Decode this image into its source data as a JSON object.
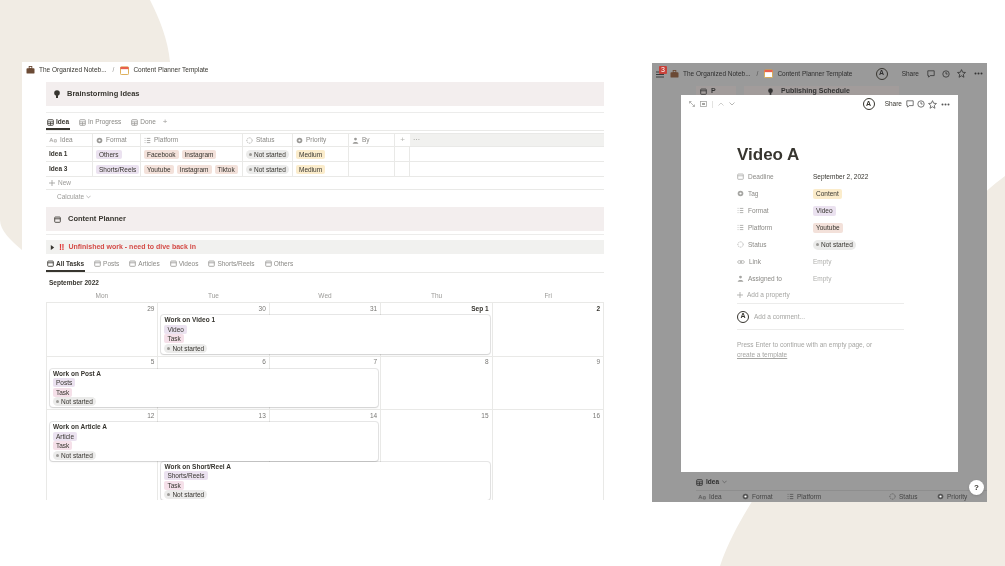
{
  "left_window": {
    "breadcrumb": [
      {
        "text": "The Organized Noteb..."
      },
      {
        "text": "Content Planner Template"
      }
    ],
    "breadcrumb_separator": "/",
    "brainstorm": {
      "title": "Brainstorming Ideas",
      "views": [
        {
          "label": "Idea",
          "selected": true
        },
        {
          "label": "In Progress",
          "selected": false
        },
        {
          "label": "Done",
          "selected": false
        }
      ],
      "add_view": "+",
      "columns": [
        {
          "label": "Idea",
          "kind": "title"
        },
        {
          "label": "Format",
          "kind": "select"
        },
        {
          "label": "Platform",
          "kind": "multi_select"
        },
        {
          "label": "Status",
          "kind": "status"
        },
        {
          "label": "Priority",
          "kind": "select"
        },
        {
          "label": "By",
          "kind": "person"
        }
      ],
      "add_column": "+",
      "more": "···",
      "rows": [
        {
          "cells": [
            {
              "text": "Idea 1"
            },
            {
              "tags": [
                {
                  "text": "Others",
                  "color": "#ebe2f0"
                }
              ]
            },
            {
              "tags": [
                {
                  "text": "Facebook",
                  "color": "#f3e1da"
                },
                {
                  "text": "Instagram",
                  "color": "#f3e1da"
                }
              ]
            },
            {
              "status": "Not started"
            },
            {
              "tags": [
                {
                  "text": "Medium",
                  "color": "#fbeccb"
                }
              ]
            }
          ]
        },
        {
          "cells": [
            {
              "text": "Idea 3"
            },
            {
              "tags": [
                {
                  "text": "Shorts/Reels",
                  "color": "#ebe2f0"
                }
              ]
            },
            {
              "tags": [
                {
                  "text": "Youtube",
                  "color": "#f3e1da"
                },
                {
                  "text": "Instagram",
                  "color": "#f3e1da"
                },
                {
                  "text": "Tiktok",
                  "color": "#f3e1da"
                }
              ]
            },
            {
              "status": "Not started"
            },
            {
              "tags": [
                {
                  "text": "Medium",
                  "color": "#fbeccb"
                }
              ]
            }
          ]
        }
      ],
      "new_label": "New",
      "calculate_label": "Calculate"
    },
    "planner": {
      "title": "Content Planner",
      "toggle": {
        "mark": "‼",
        "text": "Unfinished work - need to dive back in",
        "expanded": false
      },
      "views": [
        {
          "label": "All Tasks",
          "selected": true
        },
        {
          "label": "Posts",
          "selected": false
        },
        {
          "label": "Articles",
          "selected": false
        },
        {
          "label": "Videos",
          "selected": false
        },
        {
          "label": "Shorts/Reels",
          "selected": false
        },
        {
          "label": "Others",
          "selected": false
        }
      ],
      "month": "September 2022",
      "weekdays": [
        "Mon",
        "Tue",
        "Wed",
        "Thu",
        "Fri"
      ],
      "weeks": [
        {
          "days": [
            {
              "label": "29",
              "emphasized": false
            },
            {
              "label": "30",
              "emphasized": false
            },
            {
              "label": "31",
              "emphasized": false
            },
            {
              "label": "Sep 1",
              "emphasized": true
            },
            {
              "label": "2",
              "emphasized": true
            }
          ],
          "lanes": [
            [
              {
                "kind": "empty"
              },
              {
                "kind": "event",
                "title": "Work on Video 1",
                "tags": [
                  {
                    "text": "Video",
                    "color": "#ebe2f0"
                  },
                  {
                    "text": "Task",
                    "color": "#f5e0e9"
                  }
                ],
                "status": "Not started"
              },
              {
                "kind": "continued"
              },
              {
                "kind": "continued"
              },
              {
                "kind": "empty"
              }
            ]
          ]
        },
        {
          "days": [
            {
              "label": "5",
              "emphasized": false
            },
            {
              "label": "6",
              "emphasized": false
            },
            {
              "label": "7",
              "emphasized": false
            },
            {
              "label": "8",
              "emphasized": false
            },
            {
              "label": "9",
              "emphasized": false
            }
          ],
          "lanes": [
            [
              {
                "kind": "event",
                "title": "Work on Post A",
                "tags": [
                  {
                    "text": "Posts",
                    "color": "#ebe2f0"
                  },
                  {
                    "text": "Task",
                    "color": "#f5e0e9"
                  }
                ],
                "status": "Not started"
              },
              {
                "kind": "continued"
              },
              {
                "kind": "continued"
              },
              {
                "kind": "empty"
              },
              {
                "kind": "empty"
              }
            ]
          ]
        },
        {
          "days": [
            {
              "label": "12",
              "emphasized": false
            },
            {
              "label": "13",
              "emphasized": false
            },
            {
              "label": "14",
              "emphasized": false
            },
            {
              "label": "15",
              "emphasized": false
            },
            {
              "label": "16",
              "emphasized": false
            }
          ],
          "lanes": [
            [
              {
                "kind": "event",
                "title": "Work on Article A",
                "tags": [
                  {
                    "text": "Article",
                    "color": "#ebe2f0"
                  },
                  {
                    "text": "Task",
                    "color": "#f5e0e9"
                  }
                ],
                "status": "Not started"
              },
              {
                "kind": "continued"
              },
              {
                "kind": "continued"
              },
              {
                "kind": "empty"
              },
              {
                "kind": "empty"
              }
            ],
            [
              {
                "kind": "empty"
              },
              {
                "kind": "event",
                "title": "Work on Short/Reel A",
                "tags": [
                  {
                    "text": "Shorts/Reels",
                    "color": "#ebe2f0"
                  },
                  {
                    "text": "Task",
                    "color": "#f5e0e9"
                  }
                ],
                "status": "Not started"
              },
              {
                "kind": "continued"
              },
              {
                "kind": "continued"
              },
              {
                "kind": "empty"
              }
            ]
          ]
        }
      ]
    }
  },
  "right_window": {
    "notification_count": "3",
    "breadcrumb": [
      {
        "text": "The Organized Noteb..."
      },
      {
        "text": "Content Planner Template"
      }
    ],
    "breadcrumb_separator": "/",
    "avatar": "A",
    "share": "Share",
    "behind": {
      "tab": "P",
      "banner": "Publishing Schedule",
      "view": "Idea",
      "columns": [
        {
          "label": "Idea",
          "kind": "title"
        },
        {
          "label": "Format",
          "kind": "select"
        },
        {
          "label": "Platform",
          "kind": "multi_select"
        },
        {
          "label": "Status",
          "kind": "status"
        },
        {
          "label": "Priority",
          "kind": "select"
        }
      ]
    },
    "help": "?",
    "modal": {
      "avatar": "A",
      "share": "Share",
      "title": "Video A",
      "properties": [
        {
          "name": "Deadline",
          "kind": "date",
          "value": "September 2, 2022"
        },
        {
          "name": "Tag",
          "kind": "select",
          "value": "Content",
          "color": "#fbeccb"
        },
        {
          "name": "Format",
          "kind": "multi_select",
          "value": "Video",
          "color": "#ebe2f0"
        },
        {
          "name": "Platform",
          "kind": "multi_select",
          "value": "Youtube",
          "color": "#f3e1da"
        },
        {
          "name": "Status",
          "kind": "status",
          "value": "Not started"
        },
        {
          "name": "Link",
          "kind": "url",
          "value": "Empty"
        },
        {
          "name": "Assigned to",
          "kind": "person",
          "value": "Empty"
        }
      ],
      "add_property": "Add a property",
      "comment_avatar": "A",
      "comment_placeholder": "Add a comment...",
      "hint": "Press Enter to continue with an empty page, or",
      "template_link": "create a template"
    }
  }
}
